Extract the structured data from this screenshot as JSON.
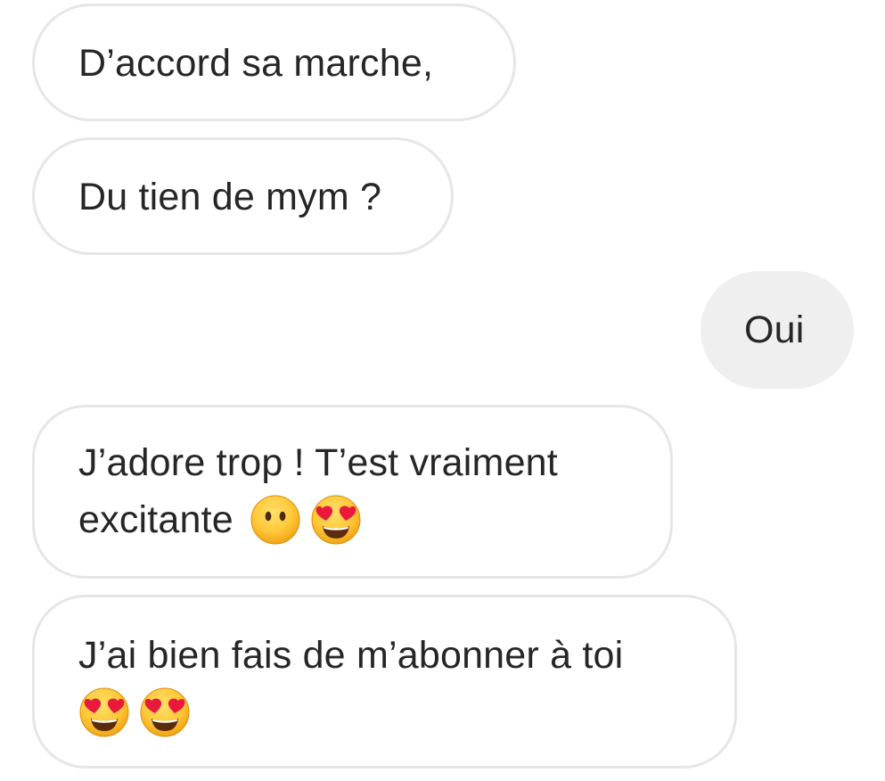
{
  "messages": [
    {
      "id": "m1",
      "side": "received",
      "lines": [
        {
          "text": "D’accord sa marche,",
          "emojis": []
        }
      ]
    },
    {
      "id": "m2",
      "side": "received",
      "lines": [
        {
          "text": "Du tien de mym ?",
          "emojis": []
        }
      ]
    },
    {
      "id": "m3",
      "side": "sent",
      "lines": [
        {
          "text": "Oui",
          "emojis": []
        }
      ]
    },
    {
      "id": "m4",
      "side": "received",
      "lines": [
        {
          "text": "J’adore trop ! T’est vraiment",
          "emojis": []
        },
        {
          "text": "excitante",
          "emojis": [
            "neutral-face-icon",
            "heart-eyes-icon"
          ]
        }
      ]
    },
    {
      "id": "m5",
      "side": "received",
      "lines": [
        {
          "text": "J’ai bien fais de m’abonner à toi",
          "emojis": []
        },
        {
          "text": "",
          "emojis": [
            "heart-eyes-icon",
            "heart-eyes-icon"
          ]
        }
      ]
    }
  ],
  "colors": {
    "received_bubble_bg": "#ffffff",
    "received_bubble_border": "#e6e6e6",
    "sent_bubble_bg": "#efefef",
    "text": "#262626"
  }
}
